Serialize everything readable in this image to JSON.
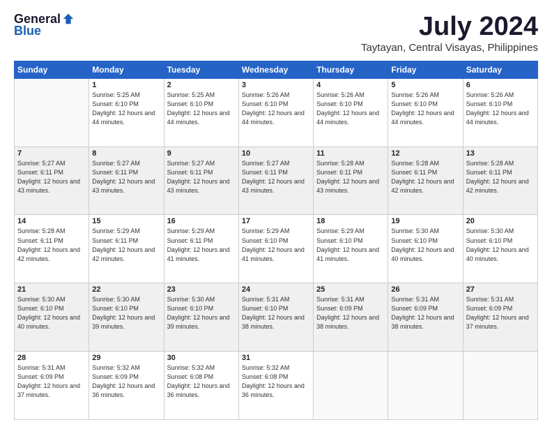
{
  "header": {
    "logo_general": "General",
    "logo_blue": "Blue",
    "month": "July 2024",
    "location": "Taytayan, Central Visayas, Philippines"
  },
  "weekdays": [
    "Sunday",
    "Monday",
    "Tuesday",
    "Wednesday",
    "Thursday",
    "Friday",
    "Saturday"
  ],
  "weeks": [
    [
      {
        "day": "",
        "sunrise": "",
        "sunset": "",
        "daylight": ""
      },
      {
        "day": "1",
        "sunrise": "5:25 AM",
        "sunset": "6:10 PM",
        "daylight": "12 hours and 44 minutes."
      },
      {
        "day": "2",
        "sunrise": "5:25 AM",
        "sunset": "6:10 PM",
        "daylight": "12 hours and 44 minutes."
      },
      {
        "day": "3",
        "sunrise": "5:26 AM",
        "sunset": "6:10 PM",
        "daylight": "12 hours and 44 minutes."
      },
      {
        "day": "4",
        "sunrise": "5:26 AM",
        "sunset": "6:10 PM",
        "daylight": "12 hours and 44 minutes."
      },
      {
        "day": "5",
        "sunrise": "5:26 AM",
        "sunset": "6:10 PM",
        "daylight": "12 hours and 44 minutes."
      },
      {
        "day": "6",
        "sunrise": "5:26 AM",
        "sunset": "6:10 PM",
        "daylight": "12 hours and 44 minutes."
      }
    ],
    [
      {
        "day": "7",
        "sunrise": "5:27 AM",
        "sunset": "6:11 PM",
        "daylight": "12 hours and 43 minutes."
      },
      {
        "day": "8",
        "sunrise": "5:27 AM",
        "sunset": "6:11 PM",
        "daylight": "12 hours and 43 minutes."
      },
      {
        "day": "9",
        "sunrise": "5:27 AM",
        "sunset": "6:11 PM",
        "daylight": "12 hours and 43 minutes."
      },
      {
        "day": "10",
        "sunrise": "5:27 AM",
        "sunset": "6:11 PM",
        "daylight": "12 hours and 43 minutes."
      },
      {
        "day": "11",
        "sunrise": "5:28 AM",
        "sunset": "6:11 PM",
        "daylight": "12 hours and 43 minutes."
      },
      {
        "day": "12",
        "sunrise": "5:28 AM",
        "sunset": "6:11 PM",
        "daylight": "12 hours and 42 minutes."
      },
      {
        "day": "13",
        "sunrise": "5:28 AM",
        "sunset": "6:11 PM",
        "daylight": "12 hours and 42 minutes."
      }
    ],
    [
      {
        "day": "14",
        "sunrise": "5:28 AM",
        "sunset": "6:11 PM",
        "daylight": "12 hours and 42 minutes."
      },
      {
        "day": "15",
        "sunrise": "5:29 AM",
        "sunset": "6:11 PM",
        "daylight": "12 hours and 42 minutes."
      },
      {
        "day": "16",
        "sunrise": "5:29 AM",
        "sunset": "6:11 PM",
        "daylight": "12 hours and 41 minutes."
      },
      {
        "day": "17",
        "sunrise": "5:29 AM",
        "sunset": "6:10 PM",
        "daylight": "12 hours and 41 minutes."
      },
      {
        "day": "18",
        "sunrise": "5:29 AM",
        "sunset": "6:10 PM",
        "daylight": "12 hours and 41 minutes."
      },
      {
        "day": "19",
        "sunrise": "5:30 AM",
        "sunset": "6:10 PM",
        "daylight": "12 hours and 40 minutes."
      },
      {
        "day": "20",
        "sunrise": "5:30 AM",
        "sunset": "6:10 PM",
        "daylight": "12 hours and 40 minutes."
      }
    ],
    [
      {
        "day": "21",
        "sunrise": "5:30 AM",
        "sunset": "6:10 PM",
        "daylight": "12 hours and 40 minutes."
      },
      {
        "day": "22",
        "sunrise": "5:30 AM",
        "sunset": "6:10 PM",
        "daylight": "12 hours and 39 minutes."
      },
      {
        "day": "23",
        "sunrise": "5:30 AM",
        "sunset": "6:10 PM",
        "daylight": "12 hours and 39 minutes."
      },
      {
        "day": "24",
        "sunrise": "5:31 AM",
        "sunset": "6:10 PM",
        "daylight": "12 hours and 38 minutes."
      },
      {
        "day": "25",
        "sunrise": "5:31 AM",
        "sunset": "6:09 PM",
        "daylight": "12 hours and 38 minutes."
      },
      {
        "day": "26",
        "sunrise": "5:31 AM",
        "sunset": "6:09 PM",
        "daylight": "12 hours and 38 minutes."
      },
      {
        "day": "27",
        "sunrise": "5:31 AM",
        "sunset": "6:09 PM",
        "daylight": "12 hours and 37 minutes."
      }
    ],
    [
      {
        "day": "28",
        "sunrise": "5:31 AM",
        "sunset": "6:09 PM",
        "daylight": "12 hours and 37 minutes."
      },
      {
        "day": "29",
        "sunrise": "5:32 AM",
        "sunset": "6:09 PM",
        "daylight": "12 hours and 36 minutes."
      },
      {
        "day": "30",
        "sunrise": "5:32 AM",
        "sunset": "6:08 PM",
        "daylight": "12 hours and 36 minutes."
      },
      {
        "day": "31",
        "sunrise": "5:32 AM",
        "sunset": "6:08 PM",
        "daylight": "12 hours and 36 minutes."
      },
      {
        "day": "",
        "sunrise": "",
        "sunset": "",
        "daylight": ""
      },
      {
        "day": "",
        "sunrise": "",
        "sunset": "",
        "daylight": ""
      },
      {
        "day": "",
        "sunrise": "",
        "sunset": "",
        "daylight": ""
      }
    ]
  ]
}
